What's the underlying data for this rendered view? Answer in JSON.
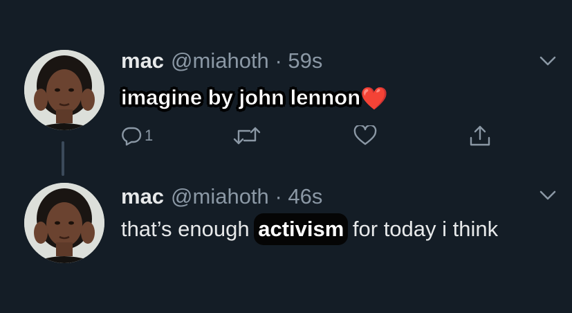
{
  "tweets": [
    {
      "name": "mac",
      "handle": "@miahoth",
      "separator": "·",
      "time": "59s",
      "text": "imagine by john lennon",
      "emoji": "❤️",
      "replies": "1",
      "icons": [
        "avatar",
        "chevron-down-icon",
        "reply-icon",
        "retweet-icon",
        "like-icon",
        "share-icon"
      ]
    },
    {
      "name": "mac",
      "handle": "@miahoth",
      "separator": "·",
      "time": "46s",
      "text_before": "that’s enough ",
      "text_highlight": "activism",
      "text_after": " for today i think",
      "icons": [
        "avatar",
        "chevron-down-icon"
      ]
    }
  ],
  "colors": {
    "background": "#141d26",
    "text": "#e7e9ea",
    "secondary": "#8b98a5",
    "thread_line": "#3b4a5a",
    "heart": "#e01e2e"
  }
}
